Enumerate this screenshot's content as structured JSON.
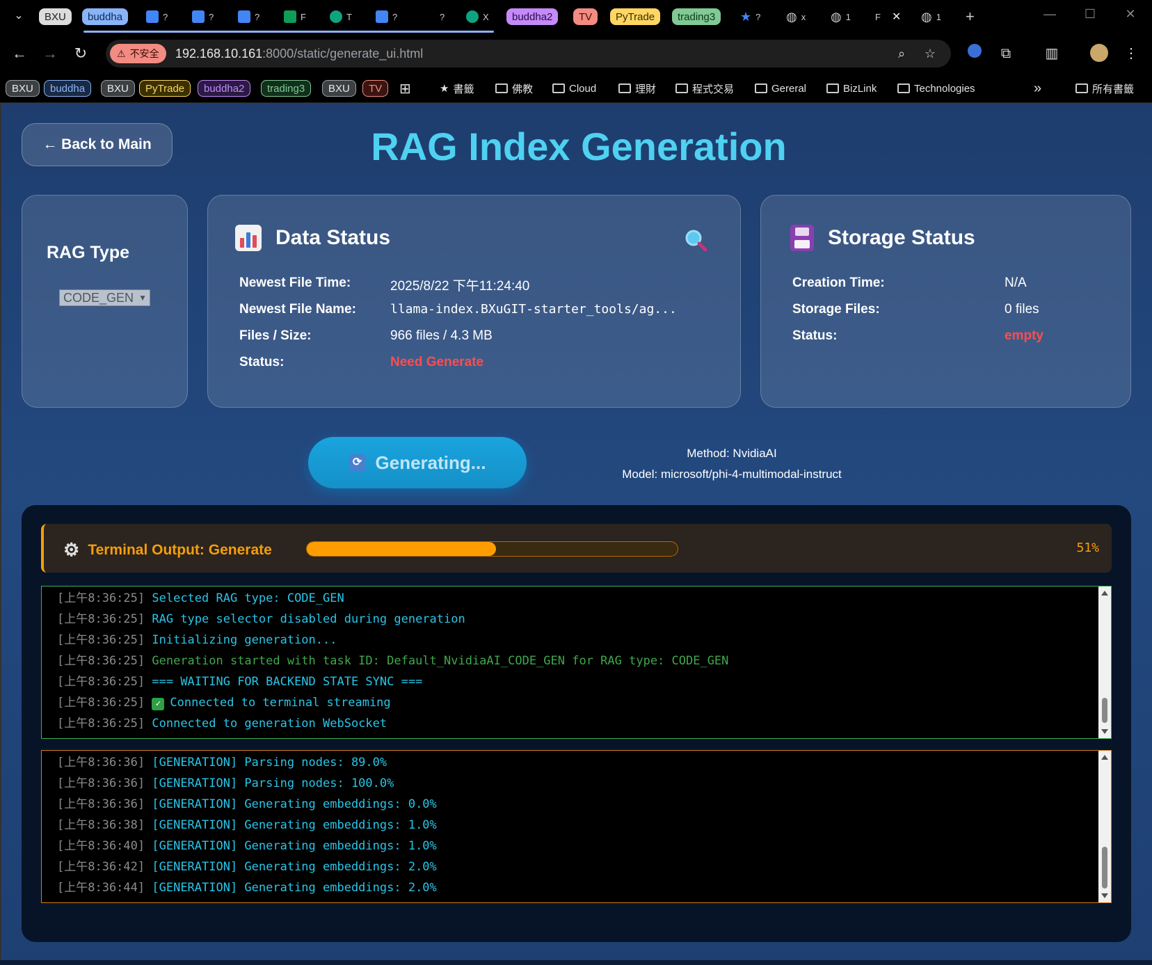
{
  "browser": {
    "tabs": [
      {
        "label": "BXU",
        "bg": "#dcdcdc",
        "fg": "#222"
      },
      {
        "label": "buddha",
        "bg": "#8ab4f8",
        "fg": "#0b2a5a"
      },
      {
        "label": "buddha2",
        "bg": "#c58af9",
        "fg": "#2a0b4a"
      },
      {
        "label": "TV",
        "bg": "#f28b82",
        "fg": "#4a0b07"
      },
      {
        "label": "PyTrade",
        "bg": "#fdd663",
        "fg": "#3d2e00"
      },
      {
        "label": "trading3",
        "bg": "#81c995",
        "fg": "#0b3a18"
      }
    ],
    "tab_snippets": [
      "?",
      "?",
      "?",
      "F",
      "T",
      "?",
      "?",
      "X",
      "?",
      "x",
      "1",
      "F",
      "1"
    ],
    "new_tab": "+",
    "insecure_label": "不安全",
    "url_host": "192.168.10.161",
    "url_rest": ":8000/static/generate_ui.html",
    "bookmarks": [
      {
        "label": "BXU",
        "type": "pill",
        "bg": "#3c4043",
        "fg": "#e8e8e8",
        "border": "#9aa0a6"
      },
      {
        "label": "buddha",
        "type": "pill",
        "bg": "#1a2a44",
        "fg": "#8ab4f8",
        "border": "#8ab4f8"
      },
      {
        "label": "BXU",
        "type": "pill",
        "bg": "#3c4043",
        "fg": "#e8e8e8",
        "border": "#9aa0a6"
      },
      {
        "label": "PyTrade",
        "type": "pill",
        "bg": "#3a3000",
        "fg": "#fdd663",
        "border": "#fdd663"
      },
      {
        "label": "buddha2",
        "type": "pill",
        "bg": "#2a1a44",
        "fg": "#c58af9",
        "border": "#c58af9"
      },
      {
        "label": "trading3",
        "type": "pill",
        "bg": "#11301c",
        "fg": "#81c995",
        "border": "#81c995"
      },
      {
        "label": "BXU",
        "type": "pill",
        "bg": "#3c4043",
        "fg": "#e8e8e8",
        "border": "#9aa0a6"
      },
      {
        "label": "TV",
        "type": "pill",
        "bg": "#3a1410",
        "fg": "#f28b82",
        "border": "#f28b82"
      }
    ],
    "bookmark_folders": [
      "書籤",
      "佛教",
      "Cloud",
      "理財",
      "程式交易",
      "Gereral",
      "BizLink",
      "Technologies"
    ],
    "more_bookmarks": "»",
    "all_bookmarks": "所有書籤"
  },
  "page": {
    "back_label": "← Back to Main",
    "title": "RAG Index Generation",
    "rag_type": {
      "title": "RAG Type",
      "selected": "CODE_GEN"
    },
    "data_status": {
      "title": "Data Status",
      "rows": [
        {
          "label": "Newest File Time:",
          "value": "2025/8/22 下午11:24:40"
        },
        {
          "label": "Newest File Name:",
          "value": "llama-index.BXuGIT-starter_tools/ag..."
        },
        {
          "label": "Files / Size:",
          "value": "966 files / 4.3 MB"
        },
        {
          "label": "Status:",
          "value": "Need Generate"
        }
      ]
    },
    "storage_status": {
      "title": "Storage Status",
      "rows": [
        {
          "label": "Creation Time:",
          "value": "N/A"
        },
        {
          "label": "Storage Files:",
          "value": "0 files"
        },
        {
          "label": "Status:",
          "value": "empty"
        }
      ]
    },
    "generate_label": "Generating...",
    "method": "Method: NvidiaAI",
    "model": "Model: microsoft/phi-4-multimodal-instruct",
    "terminal": {
      "title": "Terminal Output: Generate",
      "progress": 51,
      "progress_label": "51%",
      "log1": [
        {
          "ts": "[上午8:36:25]",
          "msg": "Selected RAG type: CODE_GEN",
          "color": "cyan"
        },
        {
          "ts": "[上午8:36:25]",
          "msg": "RAG type selector disabled during generation",
          "color": "cyan"
        },
        {
          "ts": "[上午8:36:25]",
          "msg": "Initializing generation...",
          "color": "cyan"
        },
        {
          "ts": "[上午8:36:25]",
          "msg": "Generation started with task ID: Default_NvidiaAI_CODE_GEN for RAG type: CODE_GEN",
          "color": "green"
        },
        {
          "ts": "[上午8:36:25]",
          "msg": "=== WAITING FOR BACKEND STATE SYNC ===",
          "color": "cyan"
        },
        {
          "ts": "[上午8:36:25]",
          "msg": "Connected to terminal streaming",
          "color": "cyan",
          "check": true
        },
        {
          "ts": "[上午8:36:25]",
          "msg": "Connected to generation WebSocket",
          "color": "cyan"
        }
      ],
      "log2": [
        {
          "ts": "[上午8:36:36]",
          "msg": "[GENERATION] Parsing nodes: 89.0%",
          "color": "cyan"
        },
        {
          "ts": "[上午8:36:36]",
          "msg": "[GENERATION] Parsing nodes: 100.0%",
          "color": "cyan"
        },
        {
          "ts": "[上午8:36:36]",
          "msg": "[GENERATION] Generating embeddings: 0.0%",
          "color": "cyan"
        },
        {
          "ts": "[上午8:36:38]",
          "msg": "[GENERATION] Generating embeddings: 1.0%",
          "color": "cyan"
        },
        {
          "ts": "[上午8:36:40]",
          "msg": "[GENERATION] Generating embeddings: 1.0%",
          "color": "cyan"
        },
        {
          "ts": "[上午8:36:42]",
          "msg": "[GENERATION] Generating embeddings: 2.0%",
          "color": "cyan"
        },
        {
          "ts": "[上午8:36:44]",
          "msg": "[GENERATION] Generating embeddings: 2.0%",
          "color": "cyan"
        }
      ]
    }
  }
}
